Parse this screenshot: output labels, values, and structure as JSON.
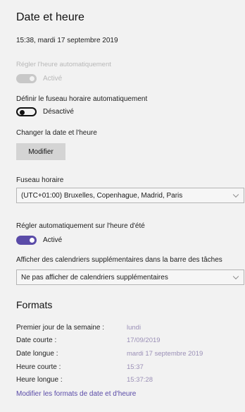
{
  "section_title": "Date et heure",
  "current_datetime": "15:38, mardi 17 septembre 2019",
  "auto_time": {
    "label": "Régler l'heure automatiquement",
    "state_text": "Activé",
    "state": "on",
    "enabled": false
  },
  "auto_timezone": {
    "label": "Définir le fuseau horaire automatiquement",
    "state_text": "Désactivé",
    "state": "off"
  },
  "change_datetime": {
    "label": "Changer la date et l'heure",
    "button_label": "Modifier"
  },
  "timezone": {
    "label": "Fuseau horaire",
    "selected": "(UTC+01:00) Bruxelles, Copenhague, Madrid, Paris"
  },
  "dst": {
    "label": "Régler automatiquement sur l'heure d'été",
    "state_text": "Activé",
    "state": "on"
  },
  "extra_calendars": {
    "label": "Afficher des calendriers supplémentaires dans la barre des tâches",
    "selected": "Ne pas afficher de calendriers supplémentaires"
  },
  "formats": {
    "title": "Formats",
    "rows": [
      {
        "key": "Premier jour de la semaine :",
        "value": "lundi"
      },
      {
        "key": "Date courte :",
        "value": "17/09/2019"
      },
      {
        "key": "Date longue :",
        "value": "mardi 17 septembre 2019"
      },
      {
        "key": "Heure courte :",
        "value": "15:37"
      },
      {
        "key": "Heure longue :",
        "value": "15:37:28"
      }
    ],
    "link": "Modifier les formats de date et d'heure"
  },
  "colors": {
    "accent": "#5a4ba8",
    "background": "#f2f2f2",
    "disabled": "#b8b8b8"
  }
}
